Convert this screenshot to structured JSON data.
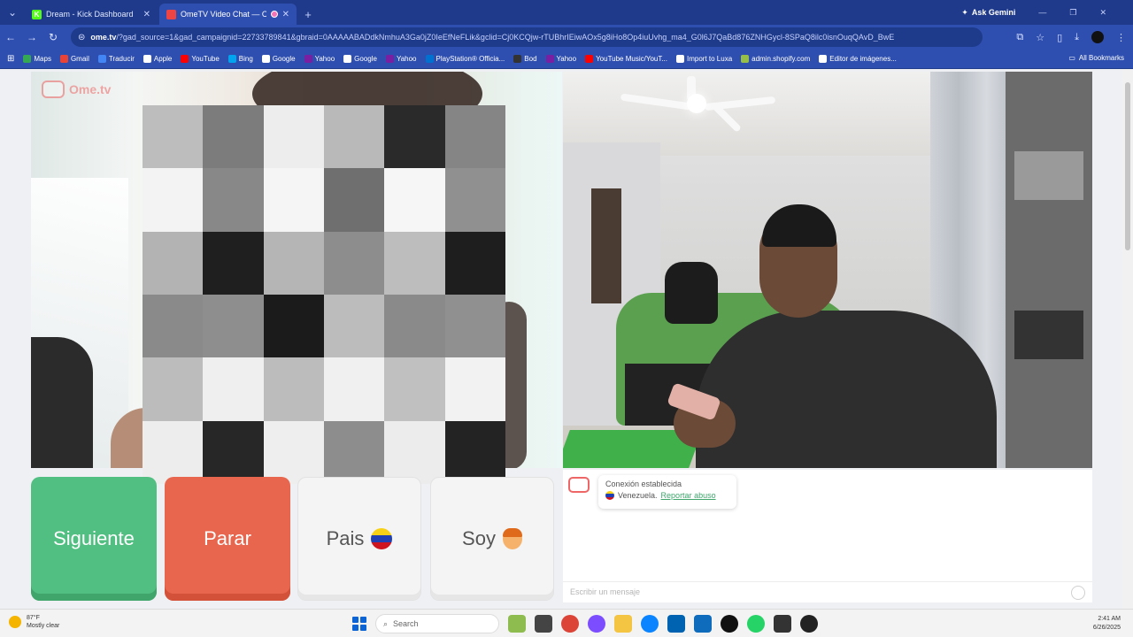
{
  "browser": {
    "tabs": [
      {
        "title": "Dream - Kick Dashboard",
        "favicon_color": "#53fc18",
        "favicon_letter": "K"
      },
      {
        "title": "OmeTV Video Chat — Ome",
        "favicon_color": "#ef4444",
        "favicon_letter": ""
      }
    ],
    "profile_name": "Ask Gemini",
    "url_host": "ome.tv",
    "url_rest": "/?gad_source=1&gad_campaignid=22733789841&gbraid=0AAAAABADdkNmhuA3Ga0jZ0IeEfNeFLik&gclid=Cj0KCQjw-rTUBhrIEiwAOx5g8iHo8Op4iuUvhg_ma4_G0l6J7QaBd876ZNHGycl-8SPaQ8ilc0isnOuqQAvD_BwE",
    "bookmarks": [
      {
        "label": "Maps",
        "color": "#34a853"
      },
      {
        "label": "Gmail",
        "color": "#ea4335"
      },
      {
        "label": "Traducir",
        "color": "#4285f4"
      },
      {
        "label": "Apple",
        "color": "#ffffff"
      },
      {
        "label": "YouTube",
        "color": "#ff0000"
      },
      {
        "label": "Bing",
        "color": "#00a4ef"
      },
      {
        "label": "Google",
        "color": "#ffffff"
      },
      {
        "label": "Yahoo",
        "color": "#7b1fa2"
      },
      {
        "label": "Google",
        "color": "#ffffff"
      },
      {
        "label": "Yahoo",
        "color": "#7b1fa2"
      },
      {
        "label": "PlayStation® Officia...",
        "color": "#0070d1"
      },
      {
        "label": "Bod",
        "color": "#333333"
      },
      {
        "label": "Yahoo",
        "color": "#7b1fa2"
      },
      {
        "label": "YouTube Music/YouT...",
        "color": "#ff0000"
      },
      {
        "label": "Import to Luxa",
        "color": "#ffffff"
      },
      {
        "label": "admin.shopify.com",
        "color": "#95bf47"
      },
      {
        "label": "Editor de imágenes...",
        "color": "#ffffff"
      }
    ],
    "all_bookmarks_label": "All Bookmarks"
  },
  "app": {
    "logo_text": "Ome.tv",
    "buttons": {
      "next": "Siguiente",
      "stop": "Parar",
      "country": "Pais",
      "gender": "Soy"
    },
    "chat": {
      "status": "Conexión establecida",
      "country": "Venezuela.",
      "report": "Reportar abuso",
      "input_placeholder": "Escribir un mensaje"
    }
  },
  "taskbar": {
    "weather_temp": "87°F",
    "weather_desc": "Mostly clear",
    "search_placeholder": "Search",
    "time": "2:41 AM",
    "date": "6/26/2025"
  },
  "pixel_tiles": [
    "#bdbdbd",
    "#7c7c7c",
    "#ededed",
    "#b9b9b9",
    "#2a2a2a",
    "#858585",
    "#f3f3f3",
    "#888888",
    "#f5f5f5",
    "#6f6f6f",
    "#f6f6f6",
    "#909090",
    "#b3b3b3",
    "#1f1f1f",
    "#b5b5b5",
    "#8d8d8d",
    "#bdbdbd",
    "#1e1e1e",
    "#8a8a8a",
    "#8e8e8e",
    "#1b1b1b",
    "#bcbcbc",
    "#8a8a8a",
    "#909090",
    "#bcbcbc",
    "#efefef",
    "#bcbcbc",
    "#f0f0f0",
    "#c0c0c0",
    "#f2f2f2",
    "#ededed",
    "#272727",
    "#eeeeee",
    "#8d8d8d",
    "#ececec",
    "#232323"
  ]
}
